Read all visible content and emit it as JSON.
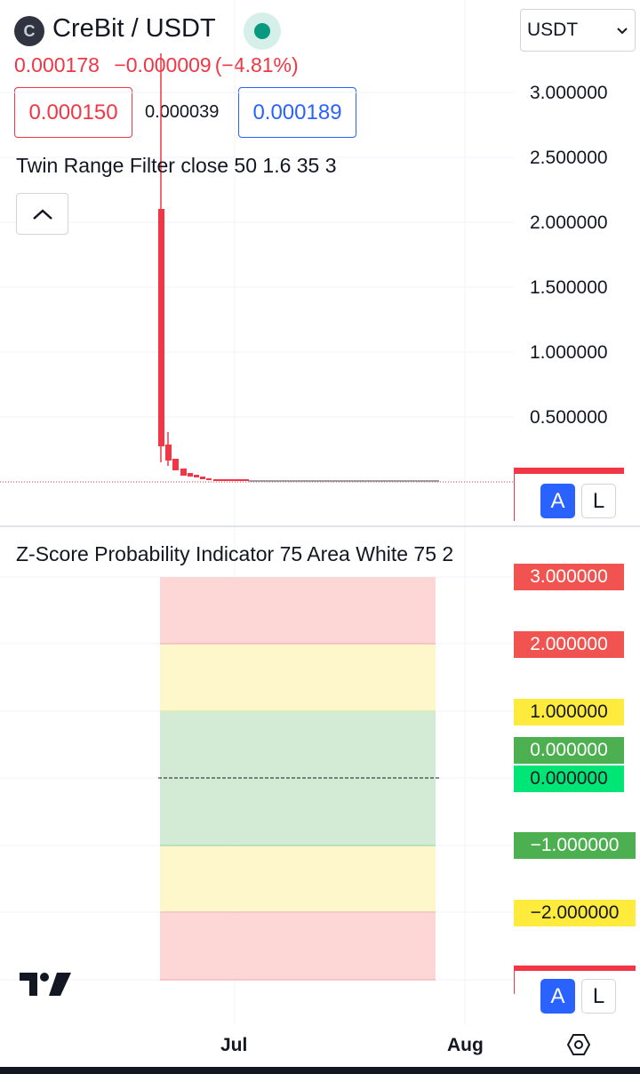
{
  "header": {
    "coin_icon_letter": "C",
    "symbol": "CreBit / USDT",
    "live_indicator": "live-dot-icon",
    "currency": "USDT",
    "last_price": "0.000178",
    "change": "−0.000009",
    "change_percent": "(−4.81%)",
    "bid": "0.000150",
    "spread": "0.000039",
    "ask": "0.000189"
  },
  "price_pane": {
    "indicator_label": "Twin Range Filter close 50 1.6 35 3",
    "scale_labels": [
      "3.000000",
      "2.500000",
      "2.000000",
      "1.500000",
      "1.000000",
      "0.500000"
    ],
    "scale_button_auto": "A",
    "scale_button_log": "L"
  },
  "zscore_pane": {
    "indicator_label": "Z-Score Probability Indicator 75 Area White 75 2",
    "badges": [
      {
        "label": "3.000000",
        "bg": "#f05350",
        "fg": "#ffffff"
      },
      {
        "label": "2.000000",
        "bg": "#f05350",
        "fg": "#ffffff"
      },
      {
        "label": "1.000000",
        "bg": "#ffeb3b",
        "fg": "#131722"
      },
      {
        "label": "0.000000",
        "bg": "#4caf50",
        "fg": "#ffffff"
      },
      {
        "label": "0.000000",
        "bg": "#00e676",
        "fg": "#131722"
      },
      {
        "label": "−1.000000",
        "bg": "#4caf50",
        "fg": "#ffffff"
      },
      {
        "label": "−2.000000",
        "bg": "#ffeb3b",
        "fg": "#131722"
      }
    ],
    "scale_button_auto": "A",
    "scale_button_log": "L"
  },
  "time_axis": {
    "labels": [
      "Jul",
      "Aug"
    ]
  },
  "colors": {
    "down": "#f23645",
    "up": "#089981",
    "accent": "#2962ff",
    "zone_red": "#fdd6d6",
    "zone_yellow": "#fef7cc",
    "zone_green": "#d3ebd4"
  }
}
